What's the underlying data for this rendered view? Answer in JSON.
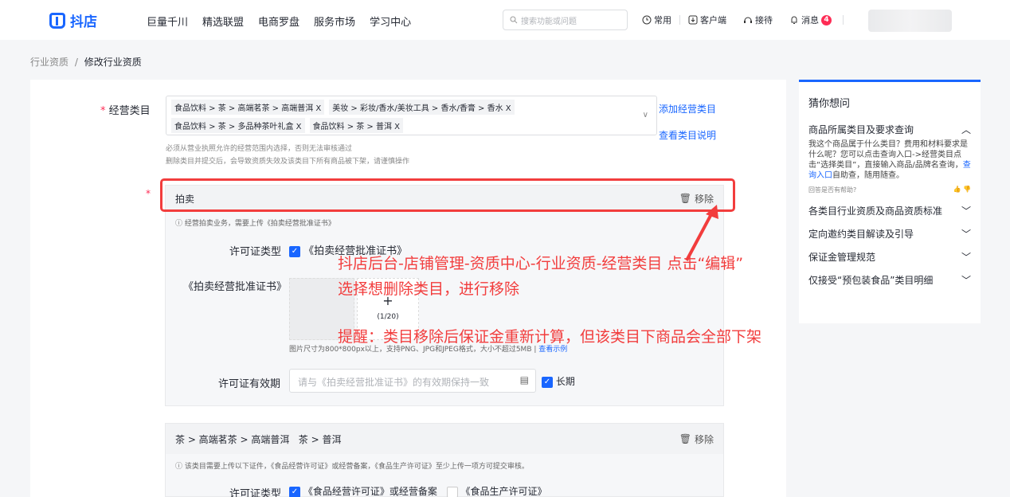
{
  "header": {
    "logo_text": "抖店",
    "nav": [
      "巨量千川",
      "精选联盟",
      "电商罗盘",
      "服务市场",
      "学习中心"
    ],
    "search_placeholder": "搜索功能或问题",
    "right_items": [
      "常用",
      "客户端",
      "接待",
      "消息"
    ],
    "message_count": "4"
  },
  "breadcrumb": {
    "parent": "行业资质",
    "sep": "/",
    "current": "修改行业资质"
  },
  "form": {
    "category_label": "经营类目",
    "tags_line1": [
      "食品饮料 > 茶 > 高端茗茶 > 高端普洱 X",
      "美妆 > 彩妆/香水/美妆工具 > 香水/香膏 > 香水 X"
    ],
    "tags_line2": [
      "食品饮料 > 茶 > 多品种茶叶礼盒 X",
      "食品饮料 > 茶 > 普洱 X"
    ],
    "add_category": "添加经营类目",
    "view_category": "查看类目说明",
    "hint1": "必须从营业执照允许的经营范围内选择，否则无法审核通过",
    "hint2": "删除类目并提交后，会导致资质失效及该类目下所有商品被下架，请谨慎操作"
  },
  "auction": {
    "title": "拍卖",
    "remove": "移除",
    "note": "经营拍卖业务，需要上传《拍卖经营批准证书》",
    "license_type_label": "许可证类型",
    "license_type_value": "《拍卖经营批准证书》",
    "cert_label": "《拍卖经营批准证书》",
    "upload_plus": "+",
    "upload_count": "(1/20)",
    "upload_hint": "图片尺寸为800*800px以上，支持PNG、JPG和JPEG格式，大小不超过5MB",
    "view_example": "查看示例",
    "validity_label": "许可证有效期",
    "validity_placeholder": "请与《拍卖经营批准证书》的有效期保持一致",
    "long_term": "长期"
  },
  "tea": {
    "title": "茶 > 高端茗茶 > 高端普洱   茶 > 普洱",
    "remove": "移除",
    "note": "该类目需要上传以下证件，《食品经营许可证》或经营备案，《食品生产许可证》至少上传一项方可提交审核。",
    "license_type_label": "许可证类型",
    "opt1": "《食品经营许可证》或经营备案",
    "opt2": "《食品生产许可证》"
  },
  "annotation": {
    "line1": "抖店后台-店铺管理-资质中心-行业资质-经营类目 点击“编辑”",
    "line2": "选择想删除类目，进行移除",
    "line3": "提醒：类目移除后保证金重新计算，但该类目下商品会全部下架"
  },
  "sidebar": {
    "title": "猜你想问",
    "expanded_title": "商品所属类目及要求查询",
    "expanded_desc": "我这个商品属于什么类目？费用和材料要求是什么呢？您可以点击查询入口->经营类目点击“选择类目”，直接输入商品/品牌名查询，",
    "expanded_link": "查询入口",
    "expanded_desc_tail": "自助查，随用随查。",
    "helpful": "回答是否有帮助?",
    "items": [
      "各类目行业资质及商品资质标准",
      "定向邀约类目解读及引导",
      "保证金管理规范",
      "仅接受“预包装食品”类目明细"
    ]
  },
  "colors": {
    "accent": "#1966ff",
    "annotation": "#f23d3d",
    "badge": "#fe2c55"
  }
}
